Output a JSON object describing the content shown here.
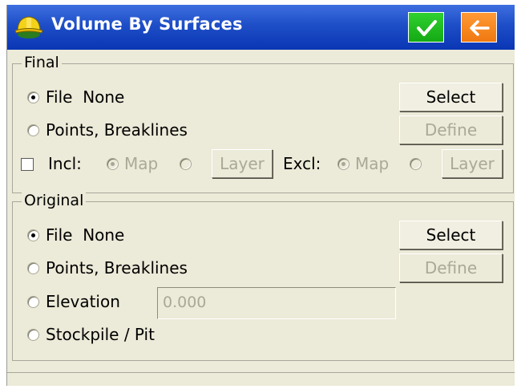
{
  "title": "Volume By Surfaces",
  "header": {
    "ok_icon": "checkmark-icon",
    "back_icon": "back-arrow-icon",
    "app_icon": "hardhat-icon"
  },
  "final": {
    "legend": "Final",
    "file_label": "File",
    "file_value": "None",
    "select_label": "Select",
    "points_label": "Points, Breaklines",
    "define_label": "Define",
    "incl_label": "Incl:",
    "incl_map": "Map",
    "incl_layer": "Layer",
    "excl_label": "Excl:",
    "excl_map": "Map",
    "excl_layer": "Layer"
  },
  "original": {
    "legend": "Original",
    "file_label": "File",
    "file_value": "None",
    "select_label": "Select",
    "points_label": "Points, Breaklines",
    "define_label": "Define",
    "elevation_label": "Elevation",
    "elevation_value": "0.000",
    "stockpile_label": "Stockpile / Pit"
  },
  "colors": {
    "titlebar": "#1e4ec7",
    "ok": "#14a914",
    "back": "#f07810",
    "panel": "#ecead8"
  }
}
